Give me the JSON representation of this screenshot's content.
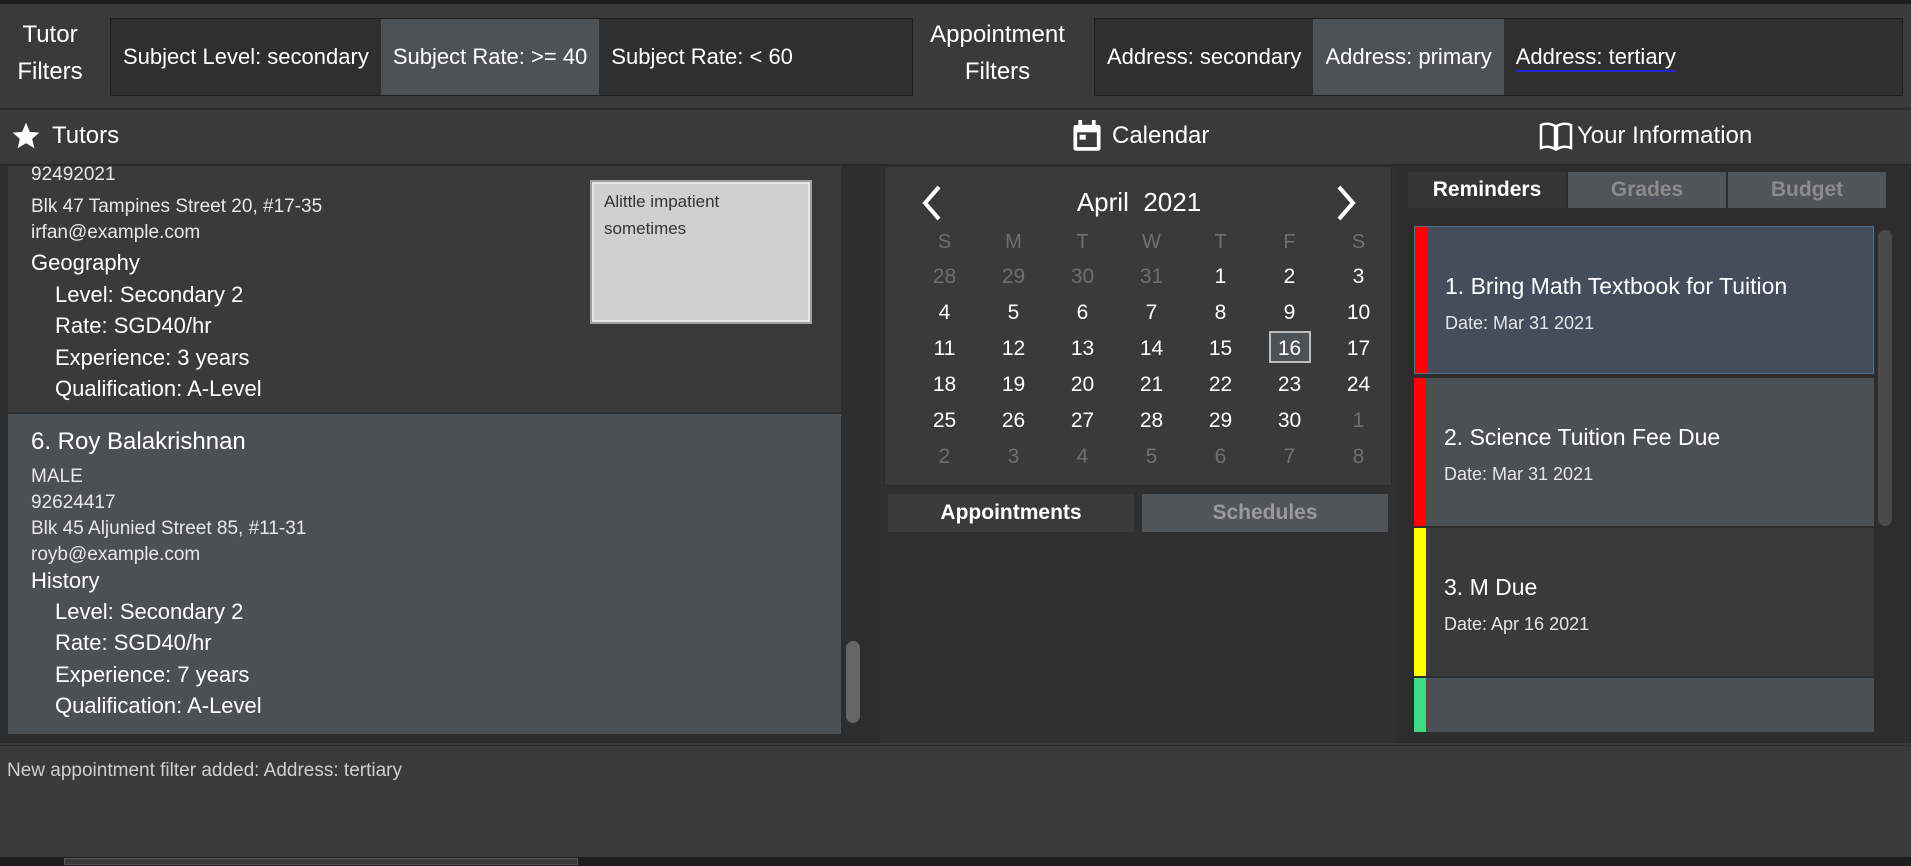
{
  "filters": {
    "tutor_label_line1": "Tutor",
    "tutor_label_line2": "Filters",
    "tutor_chips": [
      "Subject Level: secondary",
      "Subject Rate: >= 40",
      "Subject Rate: < 60"
    ],
    "appointment_label_line1": "Appointment",
    "appointment_label_line2": "Filters",
    "appointment_chips": [
      "Address: secondary",
      "Address: primary",
      "Address: tertiary"
    ]
  },
  "headers": {
    "tutors": "Tutors",
    "calendar": "Calendar",
    "your_info": "Your Information"
  },
  "tutors": {
    "card1": {
      "phone_partial": "92492021",
      "address": "Blk 47 Tampines Street 20, #17-35",
      "email": "irfan@example.com",
      "subject": "Geography",
      "level": "Level: Secondary 2",
      "rate": "Rate: SGD40/hr",
      "experience": "Experience: 3 years",
      "qualification": "Qualification: A-Level",
      "notes": "Alittle impatient sometimes"
    },
    "card2": {
      "title": "6.  Roy Balakrishnan",
      "gender": "MALE",
      "phone": "92624417",
      "address": "Blk 45 Aljunied Street 85, #11-31",
      "email": "royb@example.com",
      "subject": "History",
      "level": "Level: Secondary 2",
      "rate": "Rate: SGD40/hr",
      "experience": "Experience: 7 years",
      "qualification": "Qualification: A-Level"
    }
  },
  "calendar": {
    "month": "April",
    "year": "2021",
    "weekdays": [
      "S",
      "M",
      "T",
      "W",
      "T",
      "F",
      "S"
    ],
    "days": [
      [
        "28",
        "29",
        "30",
        "31",
        "1",
        "2",
        "3"
      ],
      [
        "4",
        "5",
        "6",
        "7",
        "8",
        "9",
        "10"
      ],
      [
        "11",
        "12",
        "13",
        "14",
        "15",
        "16",
        "17"
      ],
      [
        "18",
        "19",
        "20",
        "21",
        "22",
        "23",
        "24"
      ],
      [
        "25",
        "26",
        "27",
        "28",
        "29",
        "30",
        "1"
      ],
      [
        "2",
        "3",
        "4",
        "5",
        "6",
        "7",
        "8"
      ]
    ],
    "today": "16",
    "tab_appointments": "Appointments",
    "tab_schedules": "Schedules"
  },
  "info": {
    "tabs": [
      "Reminders",
      "Grades",
      "Budget"
    ],
    "reminders": [
      {
        "title": "1.  Bring Math Textbook for Tuition",
        "date": "Date:  Mar 31 2021",
        "color": "#ff0000"
      },
      {
        "title": "2.  Science Tuition Fee Due",
        "date": "Date:  Mar 31 2021",
        "color": "#ff0000"
      },
      {
        "title": "3.  M Due",
        "date": "Date:  Apr 16 2021",
        "color": "#ffff00"
      },
      {
        "title": "",
        "date": "",
        "color": "#3ddc84"
      }
    ]
  },
  "status": {
    "message": "New appointment filter added: Address: tertiary"
  }
}
